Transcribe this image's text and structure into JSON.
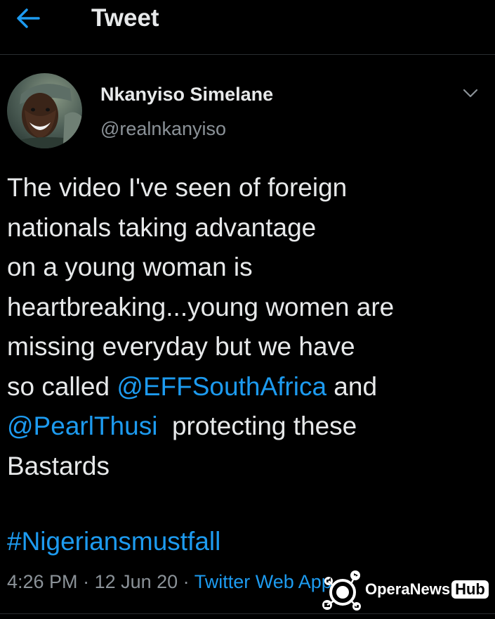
{
  "header": {
    "title": "Tweet",
    "back_icon": "arrow-left-icon",
    "accent_color": "#1d9bf0"
  },
  "author": {
    "display_name": "Nkanyiso Simelane",
    "handle": "@realnkanyiso",
    "menu_icon": "chevron-down-icon"
  },
  "tweet": {
    "line1": "The video I've seen of foreign",
    "line2": "nationals taking advantage",
    "line3": "on a young woman is",
    "line4": "heartbreaking...young women are",
    "line5": "missing everyday but we have",
    "line6_before": "so called ",
    "mention1": "@EFFSouthAfrica",
    "line6_after": " and",
    "mention2": "@PearlThusi",
    "line7_after": "  protecting these",
    "line8": "Bastards",
    "hashtag": "#Nigeriansmustfall"
  },
  "meta": {
    "time": "4:26 PM",
    "separator": " · ",
    "date": "12 Jun 20",
    "source": "Twitter Web App"
  },
  "watermark": {
    "brand": "OperaNews",
    "badge": "Hub"
  },
  "colors": {
    "background": "#000000",
    "text": "#e7e9ea",
    "secondary": "#8b9298",
    "link": "#1d9bf0",
    "divider": "#2a2d30"
  }
}
